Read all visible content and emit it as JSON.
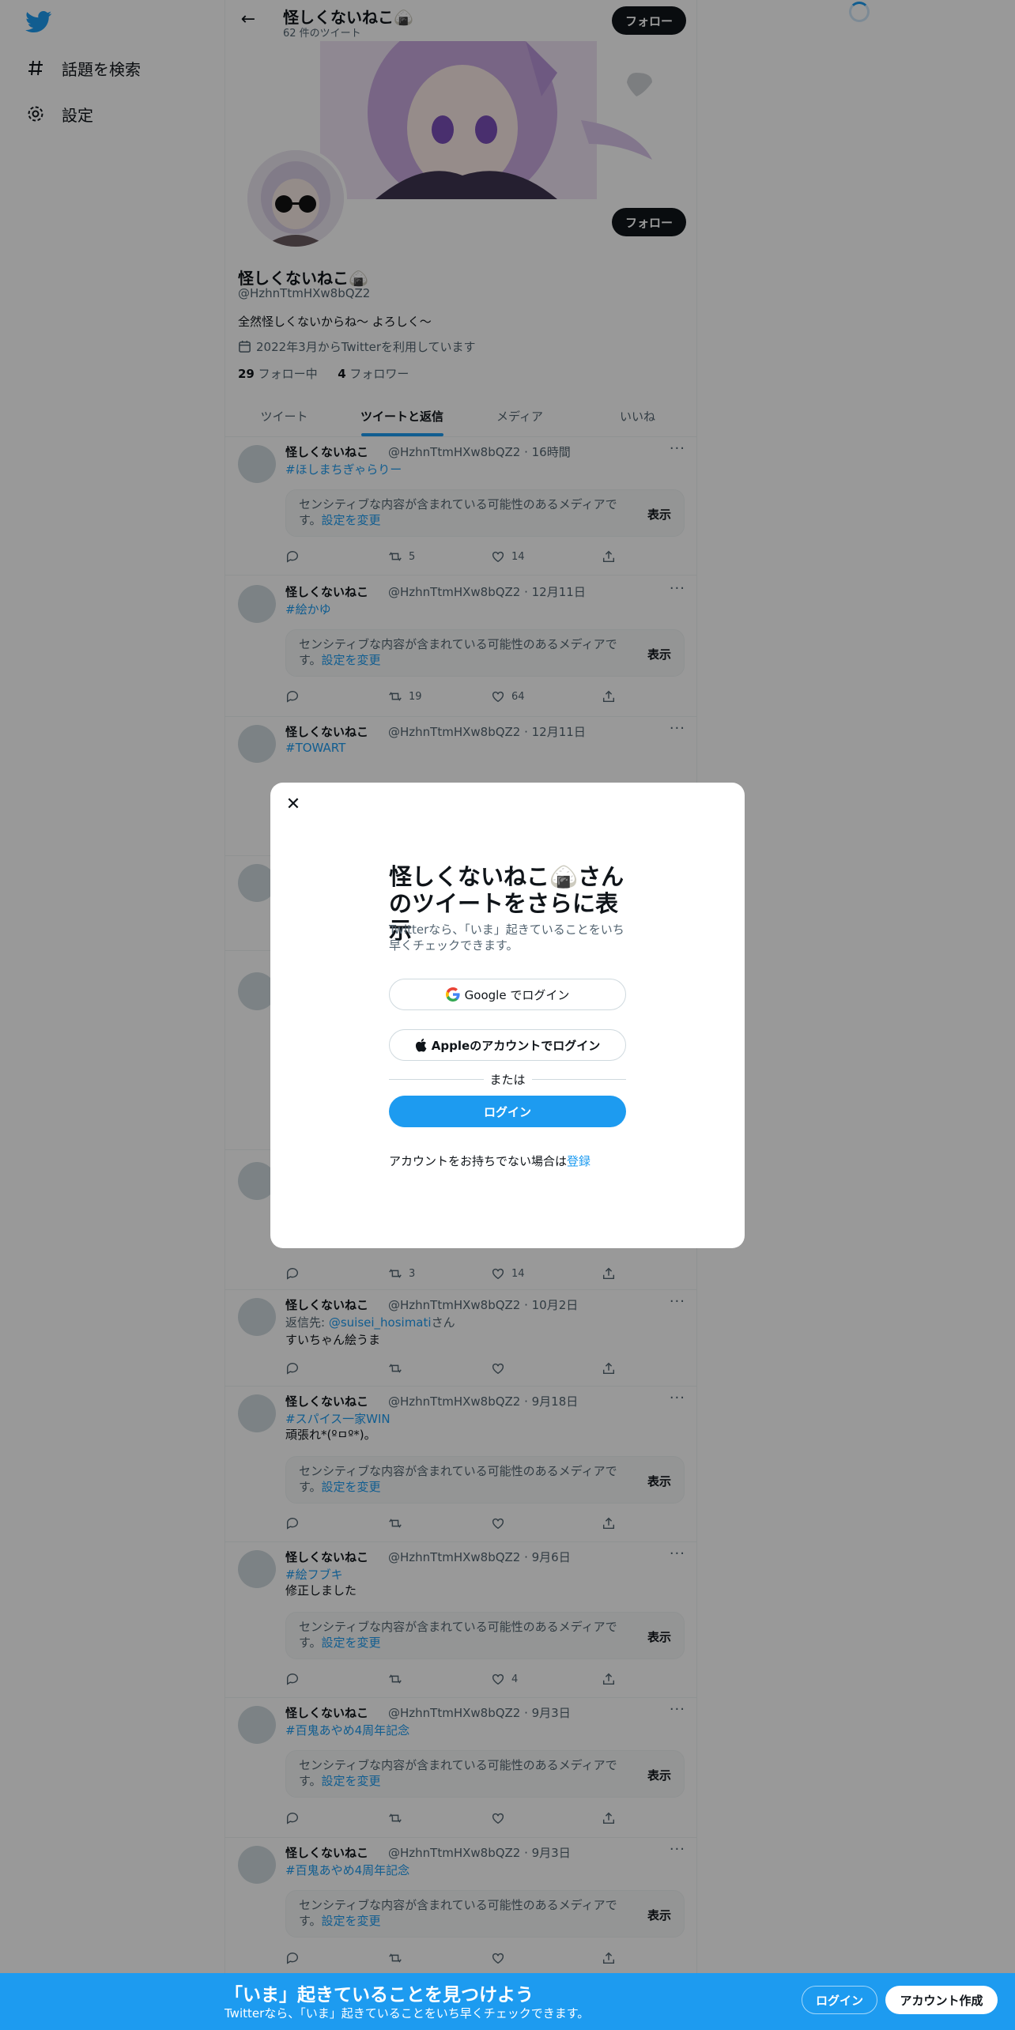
{
  "sidebar": {
    "items": [
      {
        "label": "話題を検索",
        "icon": "hashtag-icon"
      },
      {
        "label": "設定",
        "icon": "gear-icon"
      }
    ]
  },
  "header": {
    "name": "怪しくないねこ🍙",
    "tweet_count": "62 件のツイート",
    "follow_label": "フォロー"
  },
  "profile": {
    "name": "怪しくないねこ🍙",
    "handle": "@HzhnTtmHXw8bQZ2",
    "bio": "全然怪しくないからね〜 よろしく〜",
    "joined": "2022年3月からTwitterを利用しています",
    "following_count": "29",
    "following_label": " フォロー中",
    "followers_count": "4",
    "followers_label": " フォロワー",
    "follow_label": "フォロー"
  },
  "tabs": [
    "ツイート",
    "ツイートと返信",
    "メディア",
    "いいね"
  ],
  "sensitive_notice": {
    "text": "センシティブな内容が含まれている可能性のあるメディアです。",
    "link": "設定を変更",
    "show": "表示"
  },
  "tweets": [
    {
      "name": "怪しくないねこ",
      "meta": "@HzhnTtmHXw8bQZ2 · 16時間",
      "hashtag": "#ほしまちぎゃらりー",
      "retweets": "5",
      "likes": "14"
    },
    {
      "name": "怪しくないねこ",
      "meta": "@HzhnTtmHXw8bQZ2 · 12月11日",
      "hashtag": "#絵かゆ",
      "retweets": "19",
      "likes": "64"
    },
    {
      "name": "怪しくないねこ",
      "meta": "@HzhnTtmHXw8bQZ2 · 12月11日",
      "hashtag": "#TOWART"
    },
    {
      "retweets": "3",
      "likes": "14"
    },
    {
      "name": "怪しくないねこ",
      "meta": "@HzhnTtmHXw8bQZ2 · 10月2日",
      "reply_prefix": "返信先: ",
      "reply_to": "@suisei_hosimati",
      "reply_suffix": "さん",
      "text": "すいちゃん絵うま"
    },
    {
      "name": "怪しくないねこ",
      "meta": "@HzhnTtmHXw8bQZ2 · 9月18日",
      "hashtag": "#スパイス一家WIN",
      "text": "頑張れ*(ºㅁº*)。"
    },
    {
      "name": "怪しくないねこ",
      "meta": "@HzhnTtmHXw8bQZ2 · 9月6日",
      "hashtag": "#絵フブキ",
      "text": "修正しました",
      "likes": "4"
    },
    {
      "name": "怪しくないねこ",
      "meta": "@HzhnTtmHXw8bQZ2 · 9月3日",
      "hashtag": "#百鬼あやめ4周年記念"
    },
    {
      "name": "怪しくないねこ",
      "meta": "@HzhnTtmHXw8bQZ2 · 9月3日",
      "hashtag": "#百鬼あやめ4周年記念"
    }
  ],
  "modal": {
    "title": "怪しくないねこ🍙さんのツイートをさらに表示",
    "subtitle": "Twitterなら、「いま」起きていることをいち早くチェックできます。",
    "google_label": "Google でログイン",
    "apple_label": "Appleのアカウントでログイン",
    "or_label": "または",
    "login_label": "ログイン",
    "signup_prompt": "アカウントをお持ちでない場合は",
    "signup_link": "登録"
  },
  "bottom_bar": {
    "title": "「いま」起きていることを見つけよう",
    "subtitle": "Twitterなら、「いま」起きていることをいち早くチェックできます。",
    "login_label": "ログイン",
    "signup_label": "アカウント作成"
  },
  "colors": {
    "accent": "#1d9bf0",
    "text": "#0f1419",
    "muted": "#536471"
  }
}
